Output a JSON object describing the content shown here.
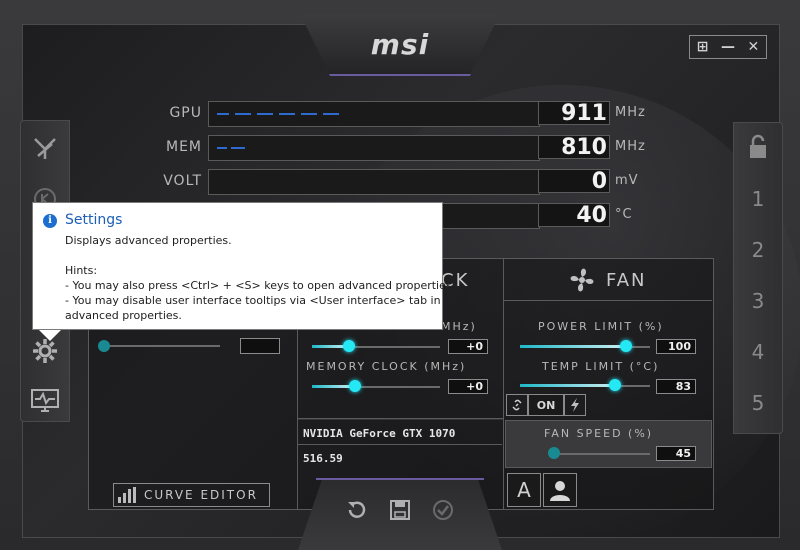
{
  "app": {
    "logo": "msi"
  },
  "window_controls": {
    "windows": "⊞",
    "minimize": "—",
    "close": "✕"
  },
  "meters": [
    {
      "label": "GPU",
      "value": "911",
      "unit": "MHz"
    },
    {
      "label": "MEM",
      "value": "810",
      "unit": "MHz"
    },
    {
      "label": "VOLT",
      "value": "0",
      "unit": "mV"
    },
    {
      "label": "",
      "value": "40",
      "unit": "°C"
    }
  ],
  "tooltip": {
    "title": "Settings",
    "icon": "i",
    "description": "Displays advanced properties.",
    "hints_header": "Hints:",
    "hint_1": "- You may also press <Ctrl> + <S> keys to open advanced properties.",
    "hint_2": "- You may disable user interface tooltips via <User interface> tab in",
    "hint_2_cont": "advanced properties."
  },
  "clock_panel": {
    "title_partial": "CK",
    "core_clock_label_partial": "MHz)",
    "core_clock_value": "+0",
    "memory_clock_label": "MEMORY CLOCK (MHz)",
    "memory_clock_value": "+0"
  },
  "fan_panel": {
    "title": "FAN",
    "power_limit_label": "POWER LIMIT (%)",
    "power_limit_value": "100",
    "temp_limit_label": "TEMP LIMIT (°C)",
    "temp_limit_value": "83",
    "link_on_label": "ON",
    "fan_speed_label": "FAN SPEED (%)",
    "fan_speed_value": "45"
  },
  "gpu_info": {
    "name": "NVIDIA GeForce GTX 1070",
    "driver": "516.59"
  },
  "curve_editor": {
    "label": "CURVE EDITOR"
  },
  "fan_mode": {
    "auto_label": "A"
  },
  "profiles": [
    "1",
    "2",
    "3",
    "4",
    "5"
  ],
  "colors": {
    "accent": "#25e8f5",
    "bar": "#2f6ad0",
    "tooltip_title": "#1c5fb5"
  }
}
